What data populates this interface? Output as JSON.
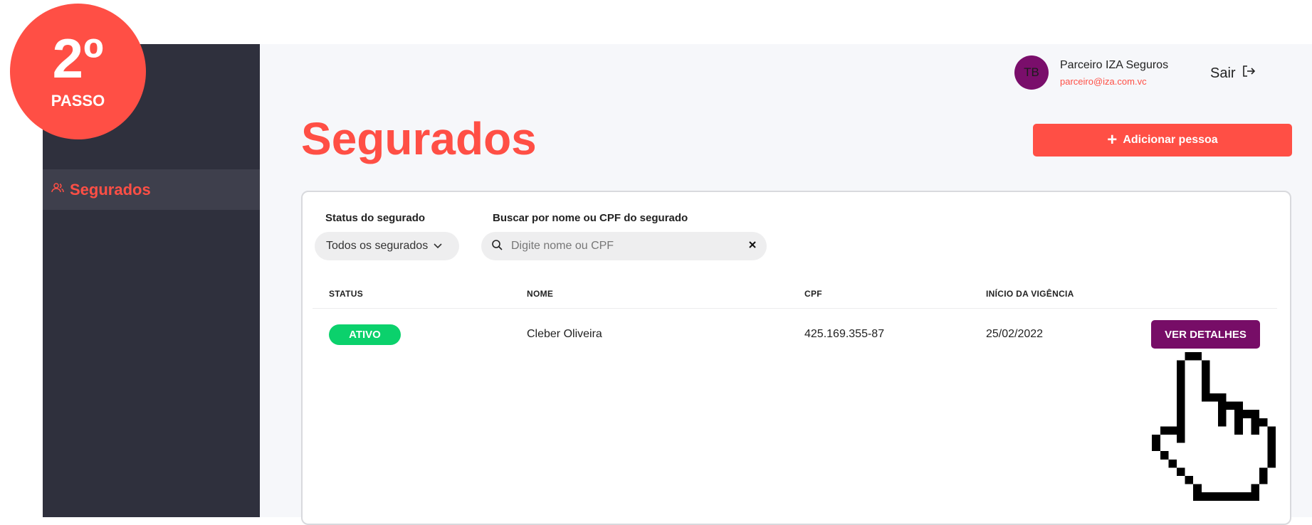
{
  "step": {
    "number": "2º",
    "label": "PASSO"
  },
  "sidebar": {
    "items": [
      {
        "label": "Segurados",
        "icon": "users-icon",
        "active": true
      }
    ]
  },
  "user": {
    "initials": "TB",
    "name": "Parceiro IZA Seguros",
    "email": "parceiro@iza.com.vc"
  },
  "logout_label": "Sair",
  "page": {
    "title": "Segurados",
    "add_button": "Adicionar pessoa"
  },
  "filters": {
    "status_label": "Status do segurado",
    "status_value": "Todos os segurados",
    "search_label": "Buscar por nome ou CPF do segurado",
    "search_placeholder": "Digite nome ou CPF"
  },
  "table": {
    "headers": [
      "STATUS",
      "NOME",
      "CPF",
      "INÍCIO DA VIGÊNCIA"
    ],
    "rows": [
      {
        "status": "ATIVO",
        "name": "Cleber Oliveira",
        "cpf": "425.169.355-87",
        "start": "25/02/2022",
        "action": "VER DETALHES"
      }
    ]
  },
  "colors": {
    "accent": "#ff4f45",
    "sidebar": "#2f303d",
    "active_status": "#0bd16c",
    "details_button": "#770d67",
    "avatar": "#7a0e6b"
  }
}
